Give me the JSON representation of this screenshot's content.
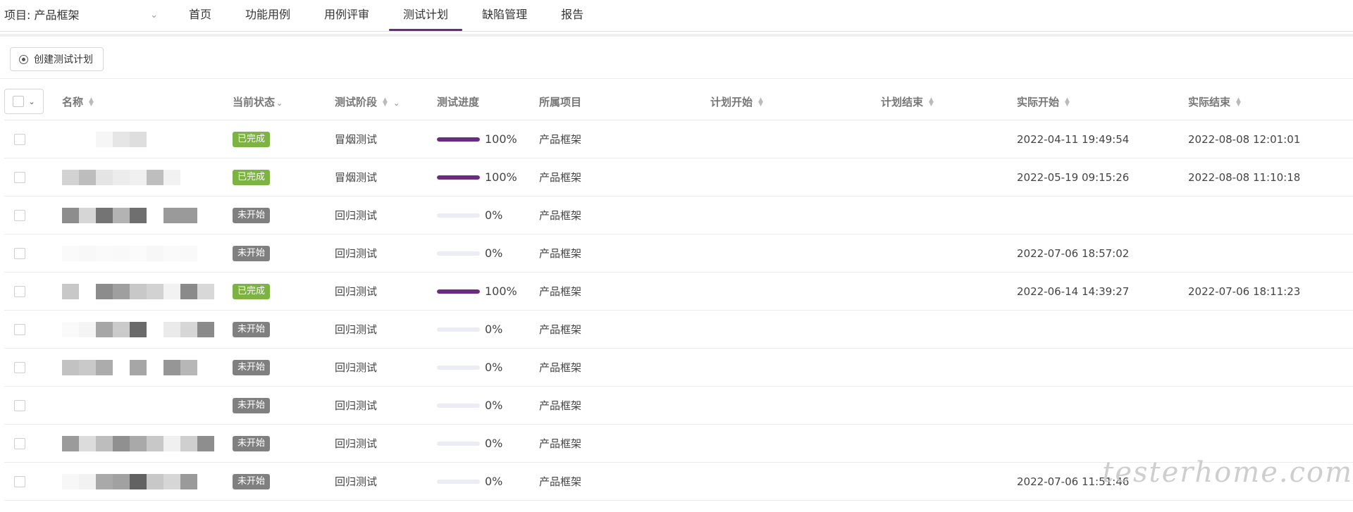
{
  "header": {
    "project_label": "项目: 产品框架",
    "tabs": [
      {
        "label": "首页",
        "active": false
      },
      {
        "label": "功能用例",
        "active": false
      },
      {
        "label": "用例评审",
        "active": false
      },
      {
        "label": "测试计划",
        "active": true
      },
      {
        "label": "缺陷管理",
        "active": false
      },
      {
        "label": "报告",
        "active": false
      }
    ]
  },
  "toolbar": {
    "create_label": "创建测试计划"
  },
  "table": {
    "columns": {
      "name": "名称",
      "status": "当前状态",
      "stage": "测试阶段",
      "progress": "测试进度",
      "project": "所属项目",
      "plan_start": "计划开始",
      "plan_end": "计划结束",
      "actual_start": "实际开始",
      "actual_end": "实际结束"
    },
    "rows": [
      {
        "status": "已完成",
        "stage": "冒烟测试",
        "progress": 1.0,
        "progress_text": "100%",
        "project": "产品框架",
        "plan_start": "",
        "plan_end": "",
        "actual_start": "2022-04-11 19:49:54",
        "actual_end": "2022-08-08 12:01:01"
      },
      {
        "status": "已完成",
        "stage": "冒烟测试",
        "progress": 1.0,
        "progress_text": "100%",
        "project": "产品框架",
        "plan_start": "",
        "plan_end": "",
        "actual_start": "2022-05-19 09:15:26",
        "actual_end": "2022-08-08 11:10:18"
      },
      {
        "status": "未开始",
        "stage": "回归测试",
        "progress": 0,
        "progress_text": "0%",
        "project": "产品框架",
        "plan_start": "",
        "plan_end": "",
        "actual_start": "",
        "actual_end": ""
      },
      {
        "status": "未开始",
        "stage": "回归测试",
        "progress": 0,
        "progress_text": "0%",
        "project": "产品框架",
        "plan_start": "",
        "plan_end": "",
        "actual_start": "2022-07-06 18:57:02",
        "actual_end": ""
      },
      {
        "status": "已完成",
        "stage": "回归测试",
        "progress": 1.0,
        "progress_text": "100%",
        "project": "产品框架",
        "plan_start": "",
        "plan_end": "",
        "actual_start": "2022-06-14 14:39:27",
        "actual_end": "2022-07-06 18:11:23"
      },
      {
        "status": "未开始",
        "stage": "回归测试",
        "progress": 0,
        "progress_text": "0%",
        "project": "产品框架",
        "plan_start": "",
        "plan_end": "",
        "actual_start": "",
        "actual_end": ""
      },
      {
        "status": "未开始",
        "stage": "回归测试",
        "progress": 0,
        "progress_text": "0%",
        "project": "产品框架",
        "plan_start": "",
        "plan_end": "",
        "actual_start": "",
        "actual_end": ""
      },
      {
        "status": "未开始",
        "stage": "回归测试",
        "progress": 0,
        "progress_text": "0%",
        "project": "产品框架",
        "plan_start": "",
        "plan_end": "",
        "actual_start": "",
        "actual_end": ""
      },
      {
        "status": "未开始",
        "stage": "回归测试",
        "progress": 0,
        "progress_text": "0%",
        "project": "产品框架",
        "plan_start": "",
        "plan_end": "",
        "actual_start": "",
        "actual_end": ""
      },
      {
        "status": "未开始",
        "stage": "回归测试",
        "progress": 0,
        "progress_text": "0%",
        "project": "产品框架",
        "plan_start": "",
        "plan_end": "",
        "actual_start": "2022-07-06 11:51:46",
        "actual_end": ""
      }
    ]
  },
  "watermark": "testerhome.com",
  "colors": {
    "accent": "#6a2c83",
    "done_badge": "#7cb342",
    "pending_badge": "#808080"
  }
}
